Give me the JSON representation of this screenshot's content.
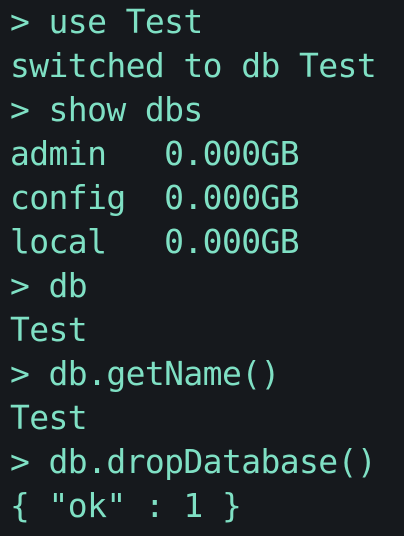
{
  "terminal": {
    "colors": {
      "background": "#16191d",
      "foreground": "#7fe0c4"
    },
    "lines": [
      "> use Test",
      "switched to db Test",
      "> show dbs",
      "admin   0.000GB",
      "config  0.000GB",
      "local   0.000GB",
      "> db",
      "Test",
      "> db.getName()",
      "Test",
      "> db.dropDatabase()",
      "{ \"ok\" : 1 }"
    ]
  }
}
